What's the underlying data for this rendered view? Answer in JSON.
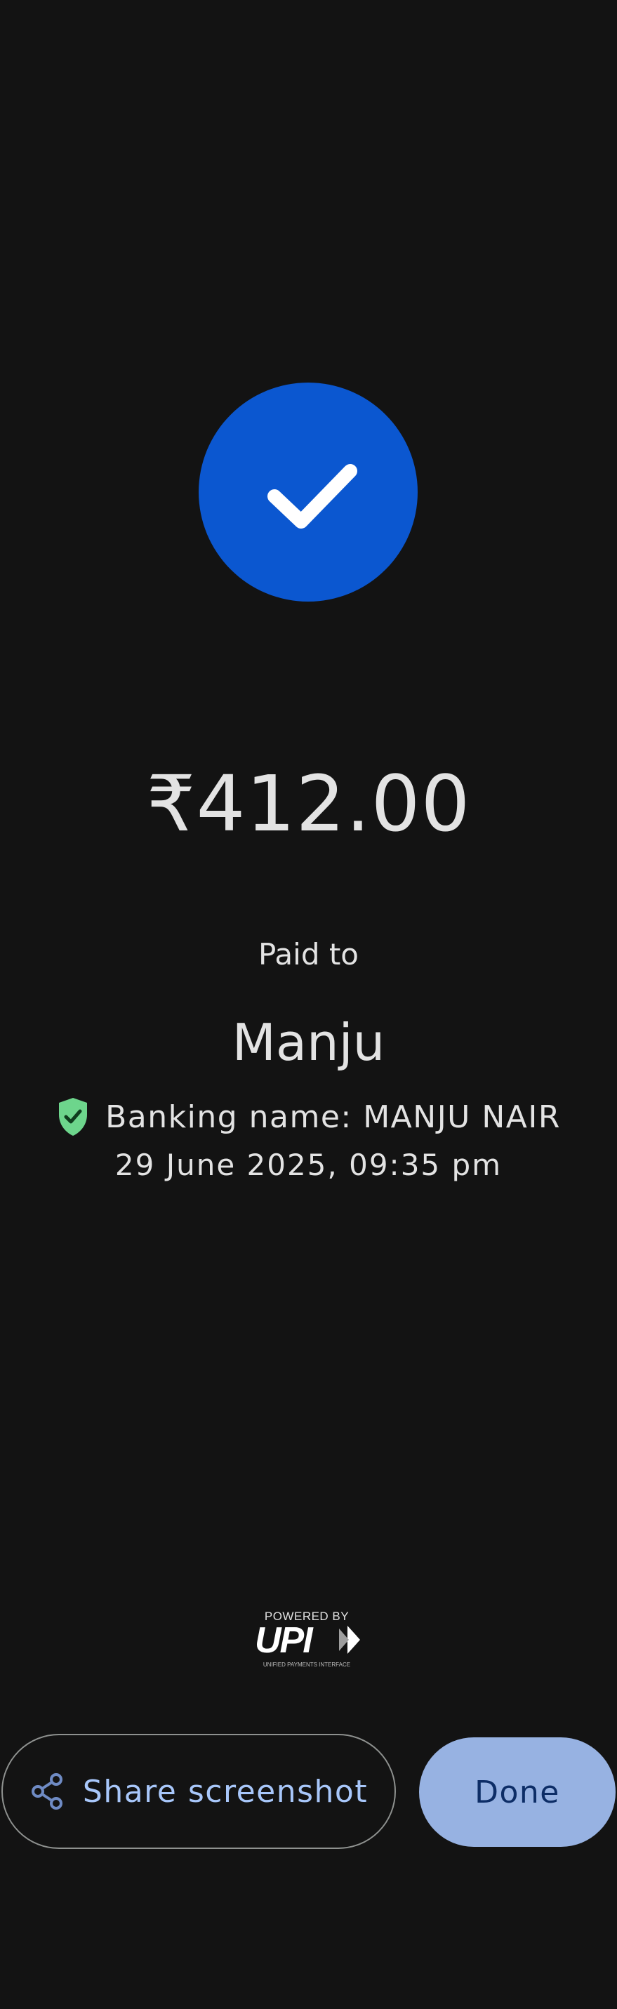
{
  "status": {
    "icon": "checkmark-icon",
    "color": "#0b57d0"
  },
  "payment": {
    "amount": "₹412.00",
    "paid_to_label": "Paid to",
    "payee_name": "Manju",
    "banking_name": "Banking name: MANJU NAIR",
    "verified_icon": "verified-shield-icon",
    "timestamp": "29 June 2025, 09:35 pm"
  },
  "footer": {
    "powered_by": "POWERED BY",
    "upi_logo_text": "UPI",
    "upi_tagline": "UNIFIED PAYMENTS INTERFACE"
  },
  "actions": {
    "share_label": "Share screenshot",
    "share_icon": "share-icon",
    "done_label": "Done"
  },
  "colors": {
    "background": "#131313",
    "accent": "#0b57d0",
    "verified_green": "#6dd58c",
    "link_blue": "#a8c7fa",
    "done_bg": "#97b2e2"
  }
}
